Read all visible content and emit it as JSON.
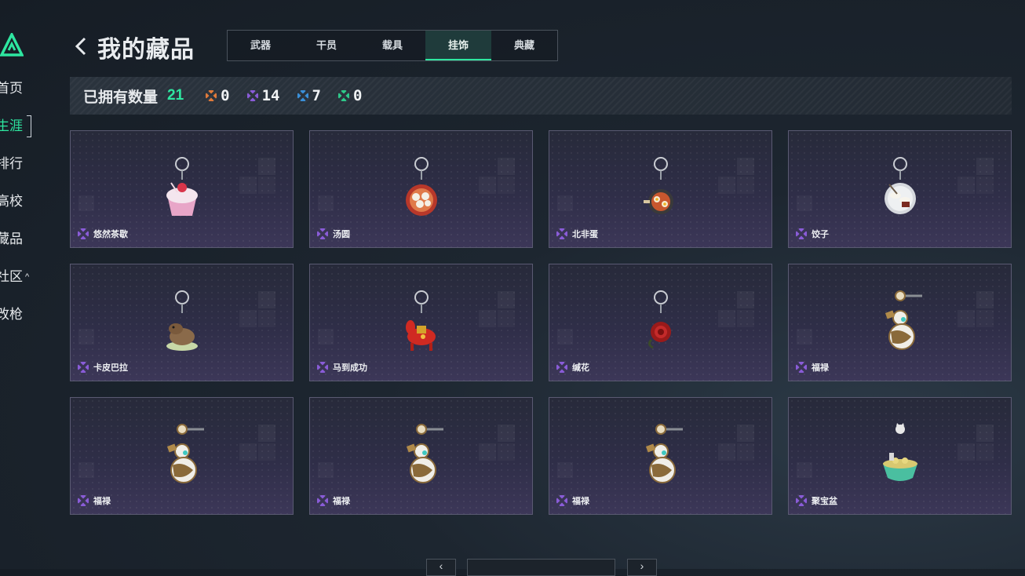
{
  "sidebar": {
    "logo": "app-logo",
    "items": [
      {
        "label": "首页",
        "active": false
      },
      {
        "label": "生涯",
        "active": true
      },
      {
        "label": "排行",
        "active": false
      },
      {
        "label": "高校",
        "active": false
      },
      {
        "label": "藏品",
        "active": false
      },
      {
        "label": "社区",
        "active": false,
        "has_caret": true
      },
      {
        "label": "改枪",
        "active": false
      }
    ]
  },
  "header": {
    "back_icon": "chevron-left-icon",
    "title": "我的藏品",
    "tabs": [
      {
        "label": "武器",
        "active": false
      },
      {
        "label": "干员",
        "active": false
      },
      {
        "label": "载具",
        "active": false
      },
      {
        "label": "挂饰",
        "active": true
      },
      {
        "label": "典藏",
        "active": false
      }
    ]
  },
  "stats": {
    "owned_label": "已拥有数量",
    "owned_count": "21",
    "rarities": [
      {
        "icon": "orange-diamond-icon",
        "color": "#e07a3a",
        "count": "0"
      },
      {
        "icon": "purple-diamond-icon",
        "color": "#8a5cd8",
        "count": "14"
      },
      {
        "icon": "blue-diamond-icon",
        "color": "#3a8fd8",
        "count": "7"
      },
      {
        "icon": "green-diamond-icon",
        "color": "#2ec98a",
        "count": "0"
      }
    ]
  },
  "items": [
    {
      "name": "悠然茶歇",
      "icon": "cupcake-charm-icon"
    },
    {
      "name": "汤圆",
      "icon": "tangyuan-bowl-charm-icon"
    },
    {
      "name": "北非蛋",
      "icon": "shakshuka-pan-charm-icon"
    },
    {
      "name": "饺子",
      "icon": "dumpling-plate-charm-icon"
    },
    {
      "name": "卡皮巴拉",
      "icon": "capybara-charm-icon"
    },
    {
      "name": "马到成功",
      "icon": "red-horse-charm-icon"
    },
    {
      "name": "缄花",
      "icon": "red-rose-charm-icon"
    },
    {
      "name": "福禄",
      "icon": "gourd-charm-icon"
    },
    {
      "name": "福禄",
      "icon": "gourd-charm-icon"
    },
    {
      "name": "福禄",
      "icon": "gourd-charm-icon"
    },
    {
      "name": "福禄",
      "icon": "gourd-charm-icon"
    },
    {
      "name": "聚宝盆",
      "icon": "treasure-bowl-charm-icon"
    }
  ],
  "item_rarity_color": "#8a5cd8",
  "accent_color": "#2ee6a0",
  "pagination": {
    "prev_icon": "chevron-left-icon",
    "next_icon": "chevron-right-icon"
  }
}
